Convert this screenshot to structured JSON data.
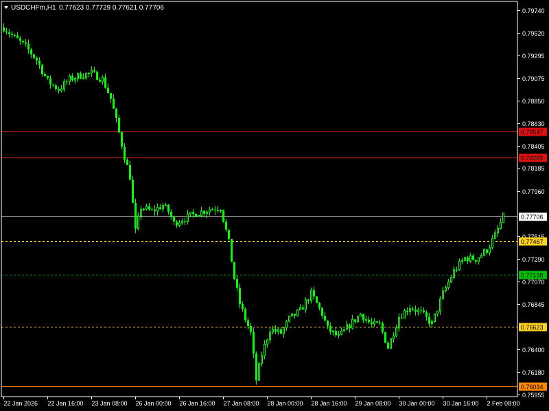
{
  "header": {
    "symbol": "USDCHFm,H1",
    "ohlc": "0.77623 0.77729 0.77621 0.77706"
  },
  "colors": {
    "background": "#000000",
    "axis": "#ffffff",
    "candle": "#00ff00",
    "resistance": "#ff2a2a",
    "yellow_level": "#ffd21f",
    "green_level": "#00c000",
    "orange_level": "#ff8a00",
    "price_line": "#c8c8c8"
  },
  "chart_data": {
    "type": "candlestick",
    "ylim": [
      0.75955,
      0.7974
    ],
    "y_ticks": [
      {
        "value": 0.7974,
        "label": "0.79740"
      },
      {
        "value": 0.7952,
        "label": "0.79520"
      },
      {
        "value": 0.79295,
        "label": "0.79295"
      },
      {
        "value": 0.79075,
        "label": "0.79075"
      },
      {
        "value": 0.7885,
        "label": "0.78850"
      },
      {
        "value": 0.7863,
        "label": "0.78630"
      },
      {
        "value": 0.78405,
        "label": "0.78405"
      },
      {
        "value": 0.78185,
        "label": "0.78185"
      },
      {
        "value": 0.7796,
        "label": "0.77960"
      },
      {
        "value": 0.77515,
        "label": "0.77515"
      },
      {
        "value": 0.7729,
        "label": "0.77290"
      },
      {
        "value": 0.7707,
        "label": "0.77070"
      },
      {
        "value": 0.76845,
        "label": "0.76845"
      },
      {
        "value": 0.764,
        "label": "0.76400"
      },
      {
        "value": 0.7618,
        "label": "0.76180"
      },
      {
        "value": 0.75955,
        "label": "0.75955"
      }
    ],
    "x_ticks": [
      {
        "index": 0,
        "label": "22 Jan 2026"
      },
      {
        "index": 16,
        "label": "22 Jan 16:00"
      },
      {
        "index": 32,
        "label": "23 Jan 08:00"
      },
      {
        "index": 48,
        "label": "26 Jan 00:00"
      },
      {
        "index": 64,
        "label": "26 Jan 16:00"
      },
      {
        "index": 80,
        "label": "27 Jan 08:00"
      },
      {
        "index": 96,
        "label": "28 Jan 00:00"
      },
      {
        "index": 112,
        "label": "28 Jan 16:00"
      },
      {
        "index": 128,
        "label": "29 Jan 08:00"
      },
      {
        "index": 144,
        "label": "30 Jan 00:00"
      },
      {
        "index": 160,
        "label": "30 Jan 16:00"
      },
      {
        "index": 176,
        "label": "2 Feb 08:00"
      }
    ],
    "levels": [
      {
        "value": 0.78547,
        "label": "0.78547",
        "style": "solid",
        "color": "#ff2a2a",
        "tag_bg": "#e01010",
        "tag_fg": "#000000"
      },
      {
        "value": 0.78289,
        "label": "0.78289",
        "style": "solid",
        "color": "#ff2a2a",
        "tag_bg": "#e01010",
        "tag_fg": "#000000"
      },
      {
        "value": 0.77706,
        "label": "0.77706",
        "style": "solid",
        "color": "#c8c8c8",
        "tag_bg": "#ffffff",
        "tag_fg": "#000000"
      },
      {
        "value": 0.77467,
        "label": "0.77467",
        "style": "dashed",
        "color": "#ffd21f",
        "tag_bg": "#ffd21f",
        "tag_fg": "#000000"
      },
      {
        "value": 0.77138,
        "label": "0.77138",
        "style": "dashed",
        "color": "#00c000",
        "tag_bg": "#00c000",
        "tag_fg": "#000000"
      },
      {
        "value": 0.76623,
        "label": "0.76623",
        "style": "dashed",
        "color": "#ffd21f",
        "tag_bg": "#ffd21f",
        "tag_fg": "#000000"
      },
      {
        "value": 0.76034,
        "label": "0.76034",
        "style": "solid",
        "color": "#ff8a00",
        "tag_bg": "#ff8a00",
        "tag_fg": "#000000"
      }
    ],
    "close_path": [
      [
        0,
        0.7957
      ],
      [
        4,
        0.7947
      ],
      [
        8,
        0.7938
      ],
      [
        12,
        0.7925
      ],
      [
        16,
        0.7904
      ],
      [
        20,
        0.7896
      ],
      [
        24,
        0.7906
      ],
      [
        28,
        0.791
      ],
      [
        32,
        0.7912
      ],
      [
        36,
        0.7906
      ],
      [
        39,
        0.7887
      ],
      [
        41,
        0.7865
      ],
      [
        44,
        0.783
      ],
      [
        46,
        0.781
      ],
      [
        48,
        0.7756
      ],
      [
        50,
        0.778
      ],
      [
        54,
        0.7776
      ],
      [
        58,
        0.7782
      ],
      [
        60,
        0.7776
      ],
      [
        62,
        0.7764
      ],
      [
        65,
        0.7768
      ],
      [
        70,
        0.7774
      ],
      [
        75,
        0.7778
      ],
      [
        79,
        0.778
      ],
      [
        82,
        0.7745
      ],
      [
        84,
        0.771
      ],
      [
        86,
        0.7685
      ],
      [
        88,
        0.767
      ],
      [
        90,
        0.7656
      ],
      [
        92,
        0.761
      ],
      [
        94,
        0.7635
      ],
      [
        97,
        0.766
      ],
      [
        101,
        0.7656
      ],
      [
        104,
        0.767
      ],
      [
        108,
        0.7678
      ],
      [
        112,
        0.7695
      ],
      [
        116,
        0.7675
      ],
      [
        118,
        0.766
      ],
      [
        122,
        0.7652
      ],
      [
        126,
        0.7664
      ],
      [
        130,
        0.7675
      ],
      [
        134,
        0.7664
      ],
      [
        137,
        0.7664
      ],
      [
        140,
        0.7642
      ],
      [
        144,
        0.7672
      ],
      [
        148,
        0.7682
      ],
      [
        152,
        0.7676
      ],
      [
        156,
        0.7665
      ],
      [
        160,
        0.7695
      ],
      [
        164,
        0.7717
      ],
      [
        168,
        0.773
      ],
      [
        172,
        0.7729
      ],
      [
        176,
        0.7738
      ],
      [
        179,
        0.7752
      ],
      [
        182,
        0.77706
      ]
    ],
    "total_bars": 183
  }
}
